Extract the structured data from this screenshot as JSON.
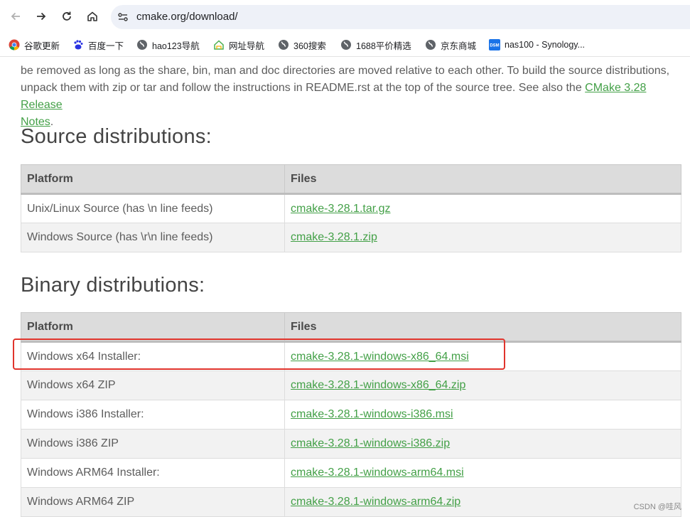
{
  "browser": {
    "url": "cmake.org/download/",
    "bookmarks": [
      {
        "label": "谷歌更新",
        "icon": "chrome-icon"
      },
      {
        "label": "百度一下",
        "icon": "baidu-icon"
      },
      {
        "label": "hao123导航",
        "icon": "globe-icon"
      },
      {
        "label": "网址导航",
        "icon": "house-icon"
      },
      {
        "label": "360搜索",
        "icon": "globe-icon"
      },
      {
        "label": "1688平价精选",
        "icon": "globe-icon"
      },
      {
        "label": "京东商城",
        "icon": "globe-icon"
      },
      {
        "label": "nas100 - Synology...",
        "icon": "dsm-icon"
      }
    ]
  },
  "intro": {
    "line1": "be removed as long as the share, bin, man and doc directories are moved relative to each other. To build the source distributions,",
    "line2_text": "unpack them with zip or tar and follow the instructions in README.rst at the top of the source tree. See also the ",
    "release_link_a": "CMake 3.28 Release",
    "release_link_b": "Notes",
    "line3_tail": "."
  },
  "source": {
    "heading": "Source distributions:",
    "col_platform": "Platform",
    "col_files": "Files",
    "rows": [
      {
        "platform": "Unix/Linux Source (has \\n line feeds)",
        "file": "cmake-3.28.1.tar.gz"
      },
      {
        "platform": "Windows Source (has \\r\\n line feeds)",
        "file": "cmake-3.28.1.zip"
      }
    ]
  },
  "binary": {
    "heading": "Binary distributions:",
    "col_platform": "Platform",
    "col_files": "Files",
    "rows": [
      {
        "platform": "Windows x64 Installer:",
        "file": "cmake-3.28.1-windows-x86_64.msi"
      },
      {
        "platform": "Windows x64 ZIP",
        "file": "cmake-3.28.1-windows-x86_64.zip"
      },
      {
        "platform": "Windows i386 Installer:",
        "file": "cmake-3.28.1-windows-i386.msi"
      },
      {
        "platform": "Windows i386 ZIP",
        "file": "cmake-3.28.1-windows-i386.zip"
      },
      {
        "platform": "Windows ARM64 Installer:",
        "file": "cmake-3.28.1-windows-arm64.msi"
      },
      {
        "platform": "Windows ARM64 ZIP",
        "file": "cmake-3.28.1-windows-arm64.zip"
      }
    ]
  },
  "watermark": "CSDN @哇风",
  "colors": {
    "link": "#43a047",
    "highlight": "#e0342c"
  }
}
